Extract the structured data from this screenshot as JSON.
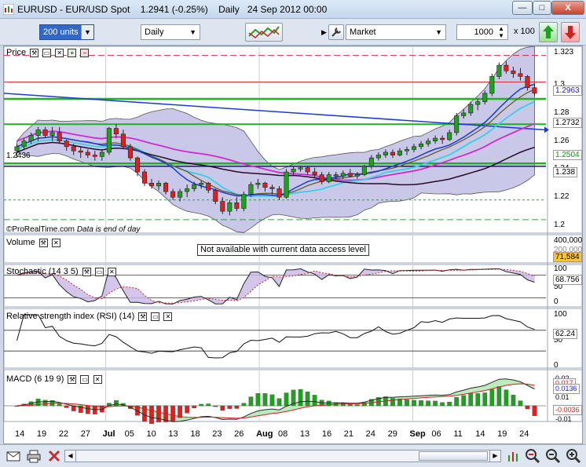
{
  "window": {
    "title": "EURUSD - EUR/USD Spot",
    "price": "1.2941 (-0.25%)",
    "period": "Daily",
    "datetime": "24 Sep 2012 00:00",
    "buttons": {
      "minimize": "—",
      "maximize": "□",
      "close": "X"
    }
  },
  "toolbar": {
    "units": "200 units",
    "timeframe": "Daily",
    "order_type": "Market",
    "quantity": "1000",
    "multiplier": "x 100"
  },
  "price_panel": {
    "label": "Price",
    "watermark_brand": "©ProRealTime.com",
    "watermark_note": "Data is end of day",
    "left_value": "1.2436",
    "axis_ticks": [
      "1.323",
      "1.3",
      "1.28",
      "1.26",
      "1.24",
      "1.22",
      "1.2"
    ],
    "tags": [
      {
        "text": "1.2963",
        "color": "#1a1ad0"
      },
      {
        "text": "1.2732",
        "color": "#000000"
      },
      {
        "text": "1.2504",
        "color": "#00a000"
      },
      {
        "text": "1.238",
        "color": "#000000"
      }
    ]
  },
  "volume_panel": {
    "label": "Volume",
    "notice": "Not available with current data access level",
    "axis_ticks": [
      "400,000",
      "200,000"
    ],
    "tag": "71,584"
  },
  "stochastic_panel": {
    "label": "Stochastic (14 3 5)",
    "axis_ticks": [
      "100",
      "50",
      "0"
    ],
    "tag": "68.756"
  },
  "rsi_panel": {
    "label": "Relative strength index (RSI) (14)",
    "axis_ticks": [
      "100",
      "50",
      "0"
    ],
    "tag": "62.24"
  },
  "macd_panel": {
    "label": "MACD (6 19 9)",
    "axis_ticks": [
      "0.02",
      "0.01",
      "0",
      "-0.01"
    ],
    "tags": [
      {
        "text": "0.017",
        "color": "#d02020"
      },
      {
        "text": "0.0136",
        "color": "#2020d0"
      },
      {
        "text": "-0.0036",
        "color": "#d02020"
      }
    ]
  },
  "x_axis": {
    "labels": [
      "14",
      "19",
      "22",
      "27",
      "Jul",
      "05",
      "10",
      "13",
      "18",
      "23",
      "26",
      "Aug",
      "08",
      "13",
      "16",
      "21",
      "24",
      "29",
      "Sep",
      "06",
      "11",
      "14",
      "19",
      "24"
    ]
  },
  "colors": {
    "bull": "#20a020",
    "bear": "#e02020",
    "bollinger_fill": "#b7b5e0",
    "ma_fast": "#1a3ad8",
    "ma_slow": "#2a0a2a",
    "ma_cyan": "#35d0e8",
    "ma_magenta": "#d02ad0",
    "ma_olive": "#6b5a2a",
    "support_green": "#20b020",
    "resistance_red": "#d03030"
  },
  "chart_data": {
    "type": "candlestick",
    "title": "EURUSD - EUR/USD Spot",
    "ylim": [
      1.2,
      1.323
    ],
    "ohlc": [
      [
        1.253,
        1.258,
        1.248,
        1.256
      ],
      [
        1.256,
        1.262,
        1.254,
        1.26
      ],
      [
        1.26,
        1.266,
        1.258,
        1.264
      ],
      [
        1.264,
        1.27,
        1.26,
        1.268
      ],
      [
        1.268,
        1.27,
        1.262,
        1.264
      ],
      [
        1.264,
        1.27,
        1.26,
        1.266
      ],
      [
        1.266,
        1.27,
        1.258,
        1.26
      ],
      [
        1.26,
        1.261,
        1.253,
        1.256
      ],
      [
        1.256,
        1.258,
        1.25,
        1.253
      ],
      [
        1.253,
        1.256,
        1.248,
        1.252
      ],
      [
        1.252,
        1.254,
        1.248,
        1.25
      ],
      [
        1.25,
        1.253,
        1.246,
        1.249
      ],
      [
        1.249,
        1.254,
        1.246,
        1.252
      ],
      [
        1.252,
        1.27,
        1.25,
        1.269
      ],
      [
        1.269,
        1.272,
        1.262,
        1.265
      ],
      [
        1.265,
        1.268,
        1.254,
        1.256
      ],
      [
        1.256,
        1.258,
        1.246,
        1.248
      ],
      [
        1.248,
        1.249,
        1.235,
        1.238
      ],
      [
        1.238,
        1.24,
        1.228,
        1.23
      ],
      [
        1.23,
        1.233,
        1.226,
        1.228
      ],
      [
        1.228,
        1.232,
        1.225,
        1.23
      ],
      [
        1.23,
        1.231,
        1.222,
        1.224
      ],
      [
        1.224,
        1.226,
        1.218,
        1.22
      ],
      [
        1.22,
        1.226,
        1.217,
        1.224
      ],
      [
        1.224,
        1.229,
        1.22,
        1.226
      ],
      [
        1.226,
        1.231,
        1.224,
        1.229
      ],
      [
        1.229,
        1.232,
        1.226,
        1.23
      ],
      [
        1.23,
        1.231,
        1.223,
        1.225
      ],
      [
        1.225,
        1.226,
        1.215,
        1.217
      ],
      [
        1.217,
        1.22,
        1.208,
        1.21
      ],
      [
        1.21,
        1.218,
        1.207,
        1.216
      ],
      [
        1.216,
        1.22,
        1.21,
        1.212
      ],
      [
        1.212,
        1.224,
        1.21,
        1.222
      ],
      [
        1.222,
        1.231,
        1.22,
        1.229
      ],
      [
        1.229,
        1.233,
        1.226,
        1.23
      ],
      [
        1.23,
        1.231,
        1.224,
        1.227
      ],
      [
        1.227,
        1.229,
        1.222,
        1.226
      ],
      [
        1.226,
        1.228,
        1.218,
        1.22
      ],
      [
        1.22,
        1.24,
        1.219,
        1.238
      ],
      [
        1.238,
        1.242,
        1.236,
        1.24
      ],
      [
        1.24,
        1.242,
        1.238,
        1.241
      ],
      [
        1.241,
        1.242,
        1.236,
        1.238
      ],
      [
        1.238,
        1.241,
        1.234,
        1.236
      ],
      [
        1.236,
        1.238,
        1.229,
        1.231
      ],
      [
        1.231,
        1.238,
        1.23,
        1.236
      ],
      [
        1.236,
        1.238,
        1.233,
        1.235
      ],
      [
        1.235,
        1.239,
        1.233,
        1.237
      ],
      [
        1.237,
        1.24,
        1.234,
        1.235
      ],
      [
        1.235,
        1.238,
        1.233,
        1.236
      ],
      [
        1.236,
        1.243,
        1.235,
        1.242
      ],
      [
        1.242,
        1.25,
        1.24,
        1.248
      ],
      [
        1.248,
        1.252,
        1.246,
        1.25
      ],
      [
        1.25,
        1.254,
        1.248,
        1.252
      ],
      [
        1.252,
        1.254,
        1.248,
        1.25
      ],
      [
        1.25,
        1.255,
        1.249,
        1.253
      ],
      [
        1.253,
        1.256,
        1.25,
        1.254
      ],
      [
        1.254,
        1.258,
        1.252,
        1.256
      ],
      [
        1.256,
        1.26,
        1.254,
        1.258
      ],
      [
        1.258,
        1.262,
        1.256,
        1.26
      ],
      [
        1.26,
        1.264,
        1.258,
        1.262
      ],
      [
        1.262,
        1.264,
        1.258,
        1.261
      ],
      [
        1.261,
        1.268,
        1.26,
        1.266
      ],
      [
        1.266,
        1.28,
        1.264,
        1.278
      ],
      [
        1.278,
        1.283,
        1.276,
        1.28
      ],
      [
        1.28,
        1.288,
        1.278,
        1.286
      ],
      [
        1.286,
        1.29,
        1.282,
        1.288
      ],
      [
        1.288,
        1.296,
        1.286,
        1.294
      ],
      [
        1.294,
        1.308,
        1.292,
        1.306
      ],
      [
        1.306,
        1.316,
        1.304,
        1.314
      ],
      [
        1.314,
        1.317,
        1.308,
        1.31
      ],
      [
        1.31,
        1.313,
        1.305,
        1.308
      ],
      [
        1.308,
        1.312,
        1.303,
        1.306
      ],
      [
        1.306,
        1.307,
        1.296,
        1.298
      ],
      [
        1.298,
        1.301,
        1.292,
        1.2941
      ]
    ]
  }
}
